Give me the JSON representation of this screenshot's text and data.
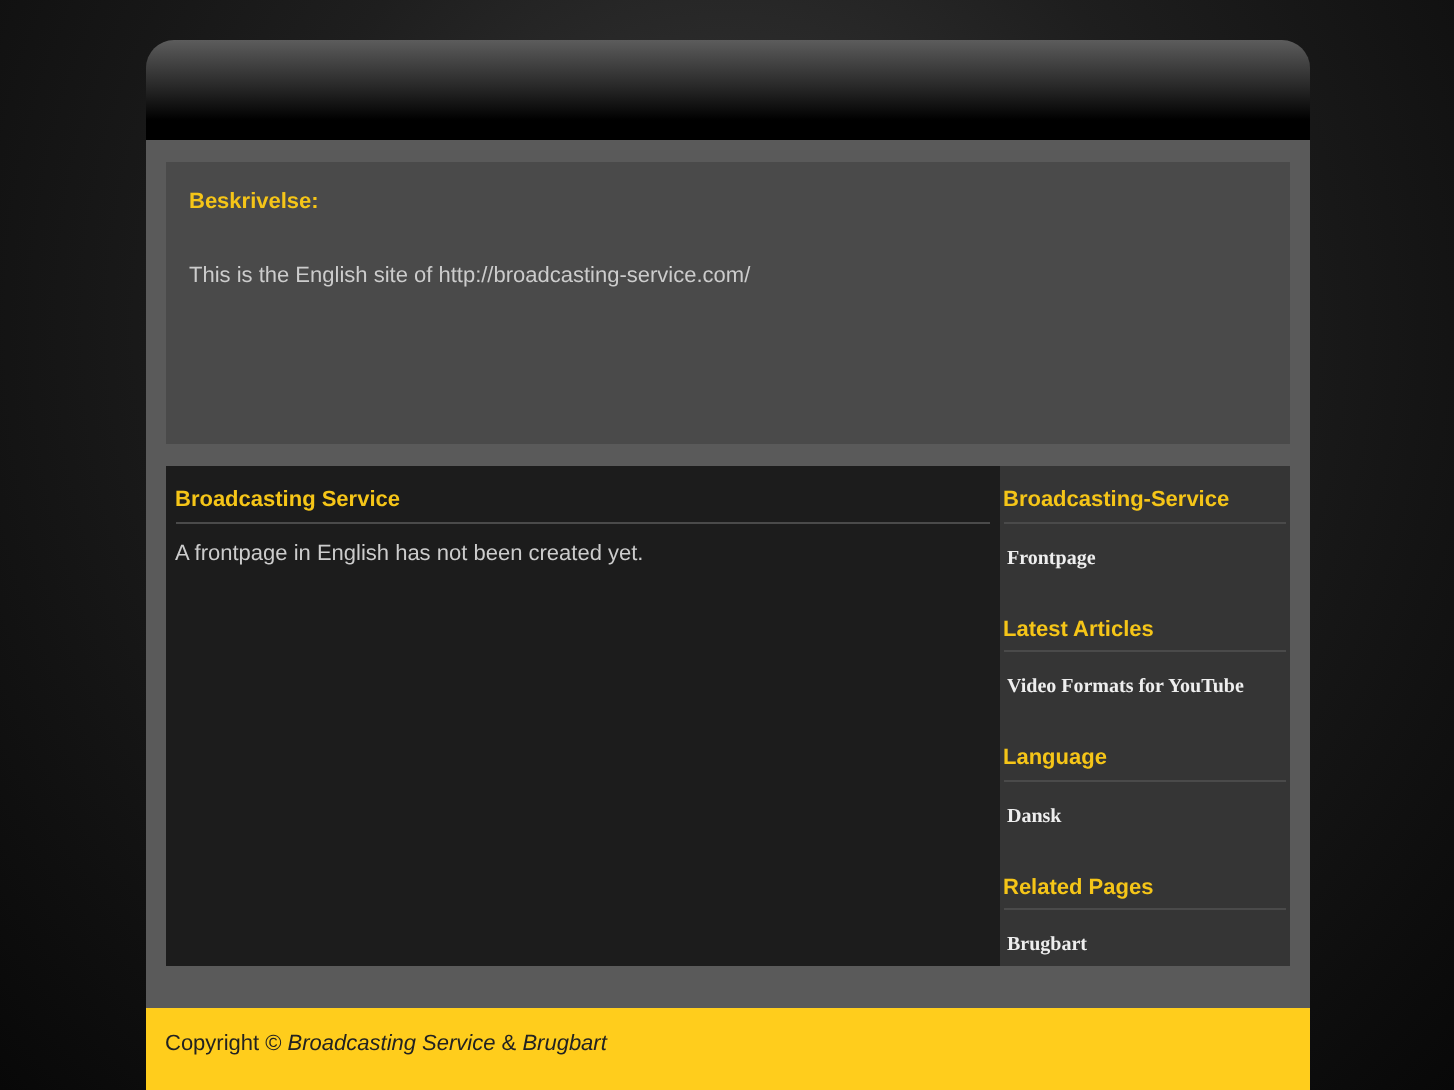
{
  "description": {
    "heading": "Beskrivelse:",
    "text": "This is the English site of http://broadcasting-service.com/"
  },
  "main": {
    "heading": "Broadcasting Service",
    "text": "A frontpage in English has not been created yet."
  },
  "sidebar": [
    {
      "heading": "Broadcasting-Service",
      "links": [
        "Frontpage"
      ]
    },
    {
      "heading": "Latest Articles",
      "links": [
        "Video Formats for YouTube"
      ]
    },
    {
      "heading": "Language",
      "links": [
        "Dansk"
      ]
    },
    {
      "heading": "Related Pages",
      "links": [
        "Brugbart"
      ]
    }
  ],
  "footer": {
    "text": "Copyright © *Broadcasting Service* & *Brugbart*"
  }
}
